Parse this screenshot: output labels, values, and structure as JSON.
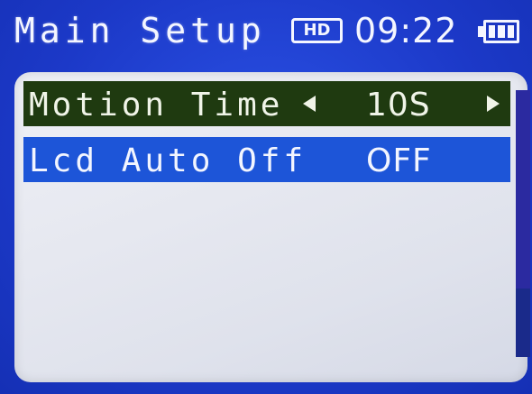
{
  "header": {
    "title": "Main Setup",
    "hd_badge": "HD",
    "time": "09:22"
  },
  "menu": {
    "items": [
      {
        "label": "Motion Time",
        "value": "10S",
        "selected": true
      },
      {
        "label": "Lcd Auto Off",
        "value": "OFF",
        "selected": false
      }
    ]
  },
  "colors": {
    "background": "#1f3fd0",
    "selected_row": "#1f3a10",
    "normal_row": "#1d55d8",
    "panel": "#e6e8f0",
    "scrollbar": "#1a2a8a"
  },
  "icons": {
    "battery": "battery-full-icon",
    "arrow_left": "triangle-left-icon",
    "arrow_right": "triangle-right-icon"
  }
}
